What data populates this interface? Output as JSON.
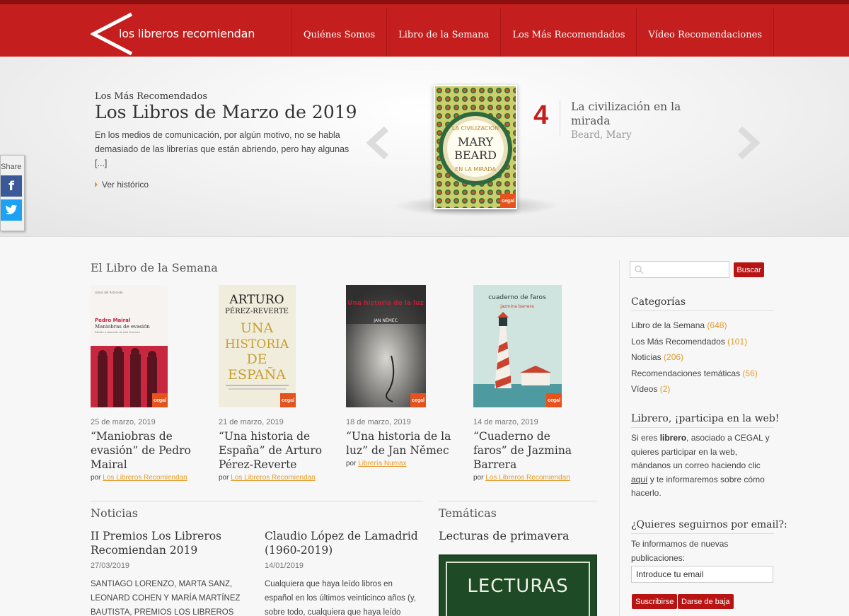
{
  "header": {
    "logo_text": "los libreros recomiendan",
    "nav": [
      "Quiénes Somos",
      "Libro de la Semana",
      "Los Más Recomendados",
      "Vídeo Recomendaciones"
    ]
  },
  "hero": {
    "kicker": "Los Más Recomendados",
    "title": "Los Libros de Marzo de 2019",
    "text": "En los medios de comunicación, por algún motivo, no se habla demasiado de las librerías que están abriendo, pero hay algunas [...]",
    "link": "Ver histórico",
    "rank": "4",
    "book_title": "La civilización en la mirada",
    "book_author": "Beard, Mary",
    "cover": {
      "top": "LA CIVILIZACIÓN",
      "name1": "MARY",
      "name2": "BEARD",
      "bottom": "EN LA MIRADA"
    }
  },
  "share": {
    "label": "Share"
  },
  "week": {
    "title": "El Libro de la Semana",
    "by_label": "por",
    "books": [
      {
        "date": "25 de marzo, 2019",
        "title": "“Maniobras de evasión” de Pedro Mairal",
        "by": "Los Libreros Recomiendan",
        "cover": {
          "publisher": "Libros del Asteroide",
          "author": "Pedro Mairal",
          "title": "Maniobras de evasión",
          "sub": "Edición a selección de Julio Guerrero"
        }
      },
      {
        "date": "21 de marzo, 2019",
        "title": "“Una historia de España” de Arturo Pérez-Reverte",
        "by": "Los Libreros Recomiendan",
        "cover": {
          "a1": "ARTURO",
          "a2": "PÉREZ-REVERTE",
          "t1": "UNA",
          "t2": "HISTORIA",
          "t3": "DE",
          "t4": "ESPAÑA"
        }
      },
      {
        "date": "18 de marzo, 2019",
        "title": "“Una historia de la luz” de Jan Němec",
        "by": "Librería Numax",
        "cover": {
          "title": "Una historia de la luz",
          "author": "JAN NĚMEC"
        }
      },
      {
        "date": "14 de marzo, 2019",
        "title": "“Cuaderno de faros” de Jazmina Barrera",
        "by": "Los Libreros Recomiendan",
        "cover": {
          "title": "cuaderno de faros",
          "author": "jazmina barrera"
        }
      }
    ]
  },
  "cegal": "cegal",
  "news": {
    "title": "Noticias",
    "items": [
      {
        "title": "II Premios Los Libreros Recomiendan 2019",
        "date": "27/03/2019",
        "text": "SANTIAGO LORENZO, MARTA SANZ, LEONARD COHEN Y MARÍA MARTÍNEZ BAUTISTA, PREMIOS LOS LIBREROS RECOMIENDAN 2019 Cinco títulos de"
      },
      {
        "title": "Claudio López de Lamadrid (1960-2019)",
        "date": "14/01/2019",
        "text": "Cualquiera que haya leído libros en español en los últimos veinticinco años (y, sobre todo, cualquiera que haya leído libros escritos en español en los últimos"
      }
    ]
  },
  "tematicas": {
    "title": "Temáticas",
    "subtitle": "Lecturas de primavera",
    "image_text": "LECTURAS"
  },
  "sidebar": {
    "search_placeholder": "",
    "search_button": "Buscar",
    "categories_title": "Categorías",
    "categories": [
      {
        "name": "Libro de la Semana",
        "count": "(648)"
      },
      {
        "name": "Los Más Recomendados",
        "count": "(101)"
      },
      {
        "name": "Noticias",
        "count": "(206)"
      },
      {
        "name": "Recomendaciones temáticas",
        "count": "(56)"
      },
      {
        "name": "Vídeos",
        "count": "(2)"
      }
    ],
    "participa_title": "Librero, ¡participa en la web!",
    "participa_1": "Si eres ",
    "participa_bold": "librero",
    "participa_2": ", asociado a CEGAL y quieres participar en la web, mándanos un correo haciendo clic ",
    "participa_link": "aquí",
    "participa_3": " y te informaremos sobre cómo hacerlo.",
    "email_title": "¿Quieres seguirnos por email?:",
    "email_text": "Te informamos de nuevas publicaciones:",
    "email_value": "Introduce tu email",
    "subscribe": "Suscribirse",
    "unsubscribe": "Darse de baja"
  }
}
